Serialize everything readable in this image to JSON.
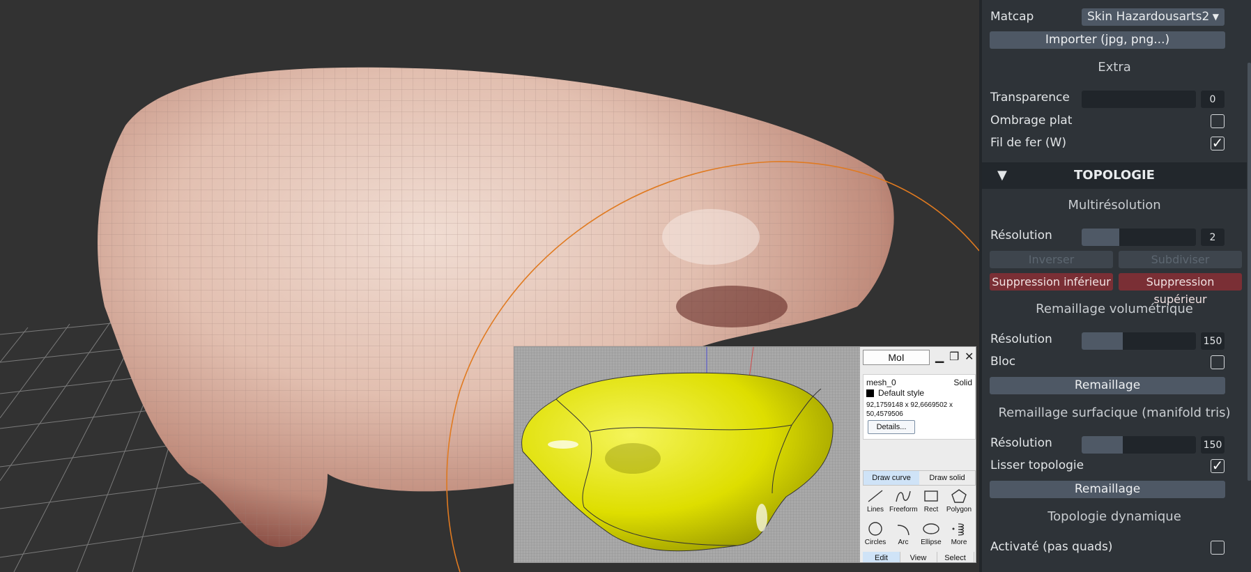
{
  "panel": {
    "matcap": {
      "label": "Matcap",
      "value": "Skin Hazardousarts2",
      "arrow": "▼"
    },
    "import_button": "Importer (jpg, png...)",
    "extra_heading": "Extra",
    "transparence": {
      "label": "Transparence",
      "value": "0",
      "fill": 0
    },
    "ombrage": {
      "label": "Ombrage plat",
      "checked": false
    },
    "fil_de_fer": {
      "label": "Fil de fer (W)",
      "checked": true
    },
    "topologie": {
      "triangle": "▼",
      "title": "TOPOLOGIE"
    },
    "multires": {
      "heading": "Multirésolution",
      "resolution_label": "Résolution",
      "resolution_value": "2",
      "resolution_fill": 0.33,
      "inverser": "Inverser",
      "subdiviser": "Subdiviser",
      "suppr_inf": "Suppression inférieur",
      "suppr_sup": "Suppression supérieur"
    },
    "volumetric": {
      "heading": "Remaillage volumétrique",
      "resolution_label": "Résolution",
      "resolution_value": "150",
      "resolution_fill": 0.36,
      "bloc_label": "Bloc",
      "bloc_checked": false,
      "button": "Remaillage"
    },
    "surface": {
      "heading": "Remaillage surfacique (manifold tris)",
      "resolution_label": "Résolution",
      "resolution_value": "150",
      "resolution_fill": 0.36,
      "smooth_label": "Lisser topologie",
      "smooth_checked": true,
      "button": "Remaillage"
    },
    "dynamic": {
      "heading": "Topologie dynamique",
      "active_label": "Activaté (pas quads)",
      "active_checked": false
    }
  },
  "moi": {
    "title": "MoI",
    "min": "▁",
    "restore": "❐",
    "close": "✕",
    "object_name": "mesh_0",
    "display_mode": "Solid",
    "style": "Default style",
    "dimensions": "92,1759148 x 92,6669502 x 50,4579506",
    "details_button": "Details...",
    "draw_curve": "Draw curve",
    "draw_solid": "Draw solid",
    "tools": [
      "Lines",
      "Freeform",
      "Rect",
      "Polygon",
      "Circles",
      "Arc",
      "Ellipse",
      "More"
    ],
    "bottom_tabs": [
      "Edit",
      "View",
      "Select"
    ]
  },
  "colors": {
    "panel_bg": "#2e3338",
    "accent_red": "#7a2f35",
    "mesh_skin": "#dcb8a8",
    "moi_yellow": "#e6e600",
    "curve_orange": "#e07a20"
  }
}
